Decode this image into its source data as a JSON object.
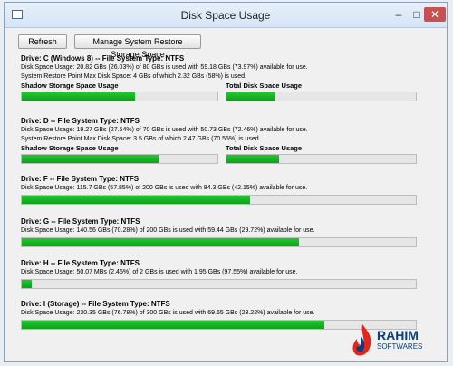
{
  "window": {
    "title": "Disk Space Usage"
  },
  "toolbar": {
    "refresh_label": "Refresh",
    "restore_label": "Manage System Restore Storage Space"
  },
  "labels": {
    "shadow": "Shadow Storage Space Usage",
    "total": "Total Disk Space Usage"
  },
  "drives": [
    {
      "title": "Drive: C (Windows 8) -- File System Type: NTFS",
      "usage": "Disk Space Usage: 20.82 GBs (26.03%) of 80 GBs is used with 59.18 GBs (73.97%) available for use.",
      "restore": "System Restore Point Max Disk Space: 4 GBs of which 2.32 GBs (58%) is used.",
      "shadow_fraction": 0.58,
      "total_fraction": 0.2603
    },
    {
      "title": "Drive: D -- File System Type: NTFS",
      "usage": "Disk Space Usage: 19.27 GBs (27.54%) of 70 GBs is used with 50.73 GBs (72.46%) available for use.",
      "restore": "System Restore Point Max Disk Space: 3.5 GBs of which 2.47 GBs (70.55%) is used.",
      "shadow_fraction": 0.7055,
      "total_fraction": 0.2754
    },
    {
      "title": "Drive: F -- File System Type: NTFS",
      "usage": "Disk Space Usage: 115.7 GBs (57.85%) of 200 GBs is used with 84.3 GBs (42.15%) available for use.",
      "total_fraction": 0.5785
    },
    {
      "title": "Drive: G -- File System Type: NTFS",
      "usage": "Disk Space Usage: 140.56 GBs (70.28%) of 200 GBs is used with 59.44 GBs (29.72%) available for use.",
      "total_fraction": 0.7028
    },
    {
      "title": "Drive: H -- File System Type: NTFS",
      "usage": "Disk Space Usage: 50.07 MBs (2.45%) of 2 GBs is used with 1.95 GBs (97.55%) available for use.",
      "total_fraction": 0.0245
    },
    {
      "title": "Drive: I (Storage) -- File System Type: NTFS",
      "usage": "Disk Space Usage: 230.35 GBs (76.78%) of 300 GBs is used with 69.65 GBs (23.22%) available for use.",
      "total_fraction": 0.7678
    }
  ],
  "watermark": {
    "name": "RAHIM",
    "sub": "SOFTWARES"
  }
}
